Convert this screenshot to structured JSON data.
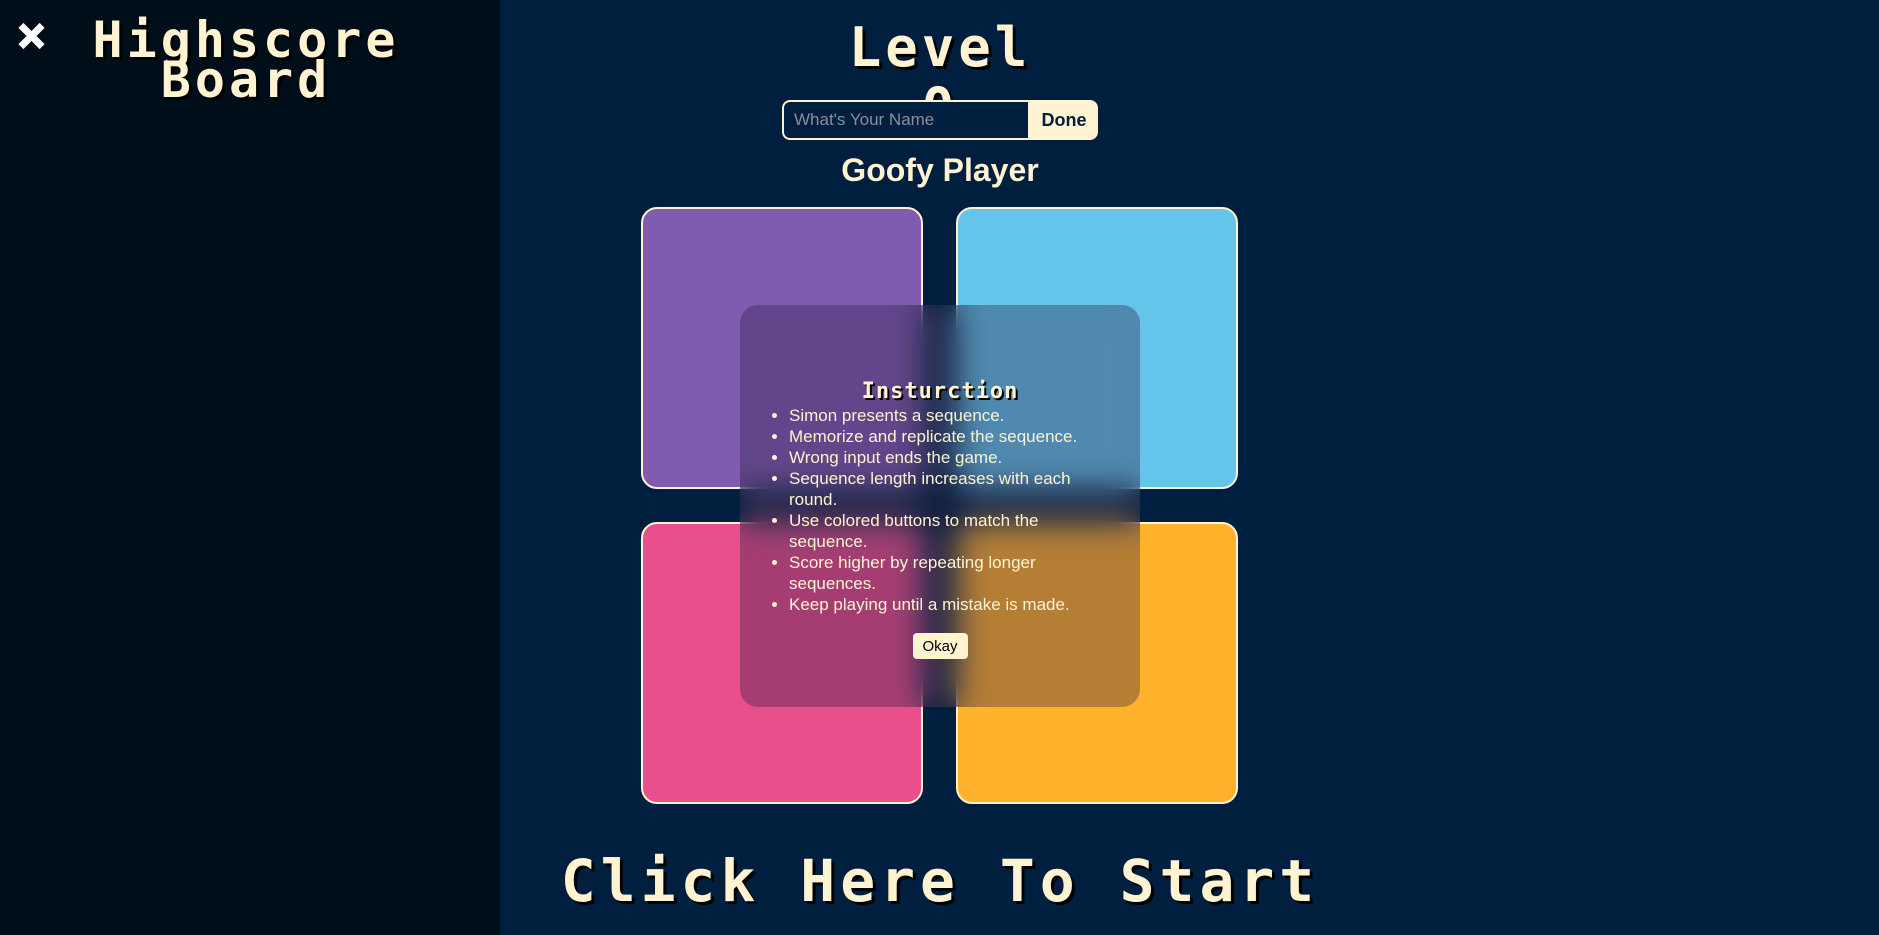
{
  "sidebar": {
    "title": "Highscore Board"
  },
  "game": {
    "level_text": "Level 0",
    "name_placeholder": "What's Your Name",
    "done_label": "Done",
    "player_name": "Goofy Player",
    "start_label": "Click Here To Start",
    "pads": [
      {
        "color": "purple",
        "hex": "#815bb0"
      },
      {
        "color": "blue",
        "hex": "#64c4ea"
      },
      {
        "color": "pink",
        "hex": "#e84f8b"
      },
      {
        "color": "orange",
        "hex": "#ffb22c"
      }
    ]
  },
  "modal": {
    "title": "Insturction",
    "rules": [
      "Simon presents a sequence.",
      "Memorize and replicate the sequence.",
      "Wrong input ends the game.",
      "Sequence length increases with each round.",
      "Use colored buttons to match the sequence.",
      "Score higher by repeating longer sequences.",
      "Keep playing until a mistake is made."
    ],
    "okay_label": "Okay"
  },
  "colors": {
    "background": "#001e3d",
    "sidebar": "#000e1a",
    "text": "#fff3d1"
  },
  "icons": {
    "close": "close-icon"
  }
}
